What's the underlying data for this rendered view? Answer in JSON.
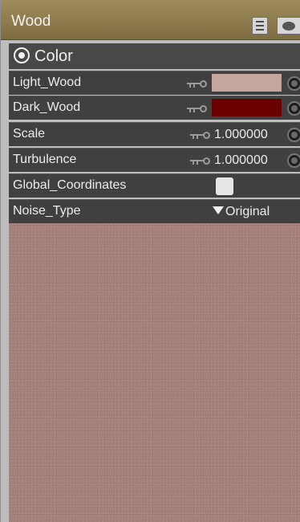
{
  "panel": {
    "title": "Wood",
    "icons": [
      "list-icon",
      "eye-icon"
    ]
  },
  "section": {
    "label": "Color",
    "icon": "target-icon"
  },
  "properties": {
    "light_wood": {
      "label": "Light_Wood",
      "color": "#c4a69d"
    },
    "dark_wood": {
      "label": "Dark_Wood",
      "color": "#6b0000"
    },
    "scale": {
      "label": "Scale",
      "value": "1.000000"
    },
    "turbulence": {
      "label": "Turbulence",
      "value": "1.000000"
    },
    "global_coordinates": {
      "label": "Global_Coordinates",
      "checked": false
    },
    "noise_type": {
      "label": "Noise_Type",
      "value": "Original"
    }
  },
  "preview": {
    "color": "#a67e79"
  }
}
